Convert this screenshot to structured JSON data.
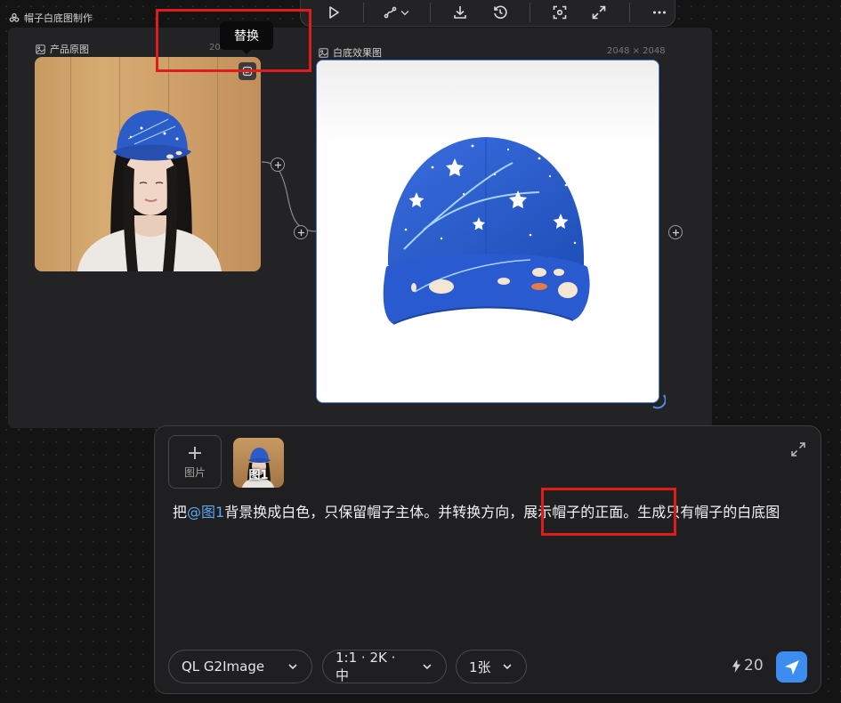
{
  "group": {
    "title": "帽子白底图制作"
  },
  "tooltip": {
    "text": "替换"
  },
  "nodes": {
    "source": {
      "label": "产品原图",
      "dims": "20"
    },
    "result": {
      "label": "白底效果图",
      "dims": "2048 × 2048"
    }
  },
  "composer": {
    "add_image_label": "图片",
    "attachment_label": "图1",
    "prompt_before": "把",
    "prompt_mention": "@图1",
    "prompt_after": "背景换成白色，只保留帽子主体。并转换方向，展示帽子的正面。生成只有帽子的白底图",
    "model": "QL G2Image",
    "size": "1:1 · 2K · 中",
    "count": "1张",
    "credits": "20"
  },
  "colors": {
    "accent": "#3d8df0",
    "mention": "#5aa8f0",
    "highlight": "#e01b1b",
    "selection": "#4a7fd8"
  }
}
